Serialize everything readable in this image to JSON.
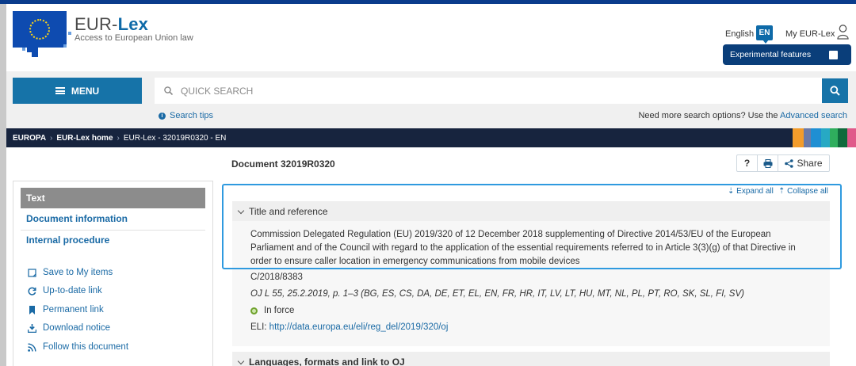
{
  "header": {
    "brand_prefix": "EUR-",
    "brand_suffix": "Lex",
    "tagline": "Access to European Union law",
    "language": "English",
    "language_code": "EN",
    "my_eurlex": "My EUR-Lex",
    "experimental": "Experimental features"
  },
  "search": {
    "menu_label": "MENU",
    "placeholder": "QUICK SEARCH",
    "tips": "Search tips",
    "advanced_prompt": "Need more search options? Use the",
    "advanced_link": "Advanced search"
  },
  "breadcrumb": [
    "EUROPA",
    "EUR-Lex home",
    "EUR-Lex - 32019R0320 - EN"
  ],
  "sidebar": {
    "active": "Text",
    "links": [
      "Document information",
      "Internal procedure"
    ],
    "actions": [
      {
        "label": "Save to My items",
        "icon": "bookmark-add-icon"
      },
      {
        "label": "Up-to-date link",
        "icon": "refresh-icon"
      },
      {
        "label": "Permanent link",
        "icon": "bookmark-icon"
      },
      {
        "label": "Download notice",
        "icon": "download-icon"
      },
      {
        "label": "Follow this document",
        "icon": "rss-icon"
      }
    ]
  },
  "document": {
    "number": "Document 32019R0320",
    "help": "?",
    "share": "Share",
    "expand_all": "Expand all",
    "collapse_all": "Collapse all",
    "section1": "Title and reference",
    "title": "Commission Delegated Regulation (EU) 2019/320 of 12 December 2018 supplementing of Directive 2014/53/EU of the European Parliament and of the Council with regard to the application of the essential requirements referred to in Article 3(3)(g) of that Directive in order to ensure caller location in emergency communications from mobile devices",
    "c_number": "C/2018/8383",
    "oj": "OJ L 55, 25.2.2019, p. 1–3 (BG, ES, CS, DA, DE, ET, EL, EN, FR, HR, IT, LV, LT, HU, MT, NL, PL, PT, RO, SK, SL, FI, SV)",
    "status": "In force",
    "eli_label": "ELI:",
    "eli_url": "http://data.europa.eu/eli/reg_del/2019/320/oj",
    "section2": "Languages, formats and link to OJ"
  },
  "colors": {
    "accent": "#1673a8",
    "highlight": "#2f9adf",
    "nav": "#17243e",
    "bands": [
      "#f39c2b",
      "#6b7aa8",
      "#1f8fd3",
      "#27a9c4",
      "#2fae5d",
      "#0f6a3c",
      "#e05a8a"
    ]
  }
}
